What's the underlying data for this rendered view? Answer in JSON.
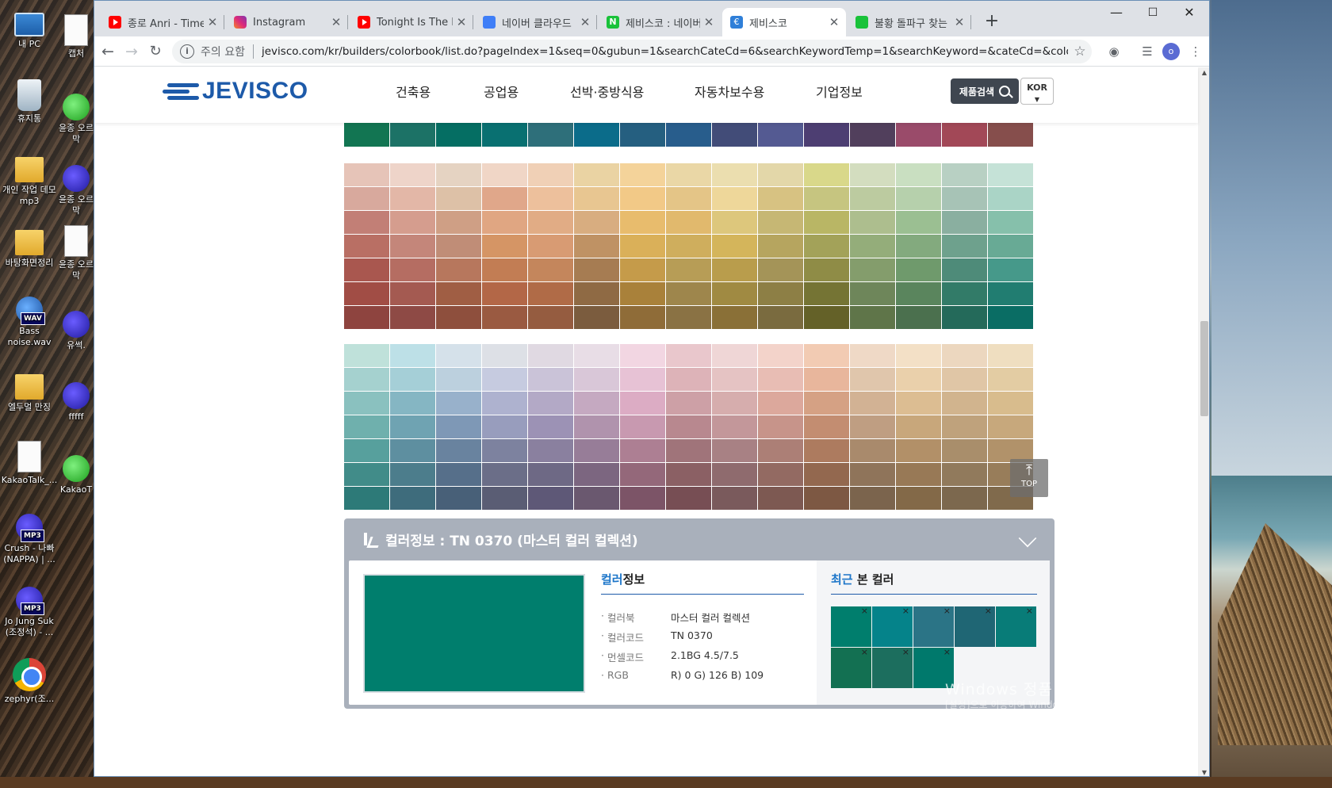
{
  "desktop": {
    "icons": [
      {
        "label": "내 PC",
        "kind": "pc",
        "badge": ""
      },
      {
        "label": "캡처",
        "kind": "doc",
        "badge": ""
      },
      {
        "label": "휴지통",
        "kind": "bin",
        "badge": ""
      },
      {
        "label": "윤종 오르막",
        "kind": "kakao",
        "badge": ""
      },
      {
        "label": "개인 작업 데모 mp3",
        "kind": "folder",
        "badge": ""
      },
      {
        "label": "윤종 오르막",
        "kind": "mp3",
        "badge": ""
      },
      {
        "label": "바탕화면정리",
        "kind": "folder",
        "badge": ""
      },
      {
        "label": "윤종 오르막",
        "kind": "doc",
        "badge": ""
      },
      {
        "label": "Bass noise.wav",
        "kind": "wav",
        "badge": "WAV"
      },
      {
        "label": "유썩.",
        "kind": "mp3",
        "badge": ""
      },
      {
        "label": "엘두멀 만징",
        "kind": "folder",
        "badge": ""
      },
      {
        "label": "fffff",
        "kind": "mp3",
        "badge": ""
      },
      {
        "label": "KakaoTalk_...",
        "kind": "doc",
        "badge": ""
      },
      {
        "label": "KakaoT",
        "kind": "kakao",
        "badge": ""
      },
      {
        "label": "Crush - 나빠 (NAPPA) | ...",
        "kind": "mp3",
        "badge": "MP3"
      },
      {
        "label": "Jo Jung Suk (조정석) - ...",
        "kind": "mp3",
        "badge": "MP3"
      },
      {
        "label": "zephyr(조...",
        "kind": "chrome",
        "badge": ""
      }
    ],
    "watermark_title": "Windows 정품 인증",
    "watermark_sub": "[설정]으로 이동하여 Windows를 정품 인증합니다."
  },
  "browser": {
    "tabs": [
      {
        "title": "종로 Anri - Timely",
        "favicon": "yt"
      },
      {
        "title": "Instagram",
        "favicon": "ig"
      },
      {
        "title": "Tonight Is The Nig",
        "favicon": "yt"
      },
      {
        "title": "네이버 클라우드",
        "favicon": "nc"
      },
      {
        "title": "제비스코 : 네이버",
        "favicon": "nv"
      },
      {
        "title": "제비스코",
        "favicon": "jv"
      },
      {
        "title": "불황 돌파구 찾는",
        "favicon": "gr"
      }
    ],
    "new_tab": "+",
    "window_controls": {
      "minimize": "—",
      "maximize": "☐",
      "close": "✕"
    },
    "security_text": "주의 요함",
    "url": "jevisco.com/kr/builders/colorbook/list.do?pageIndex=1&seq=0&gubun=1&searchCateCd=6&searchKeywordTemp=1&searchKeyword=&cateCd=&colorch...",
    "profile_initial": "o"
  },
  "site": {
    "logo": "JEVISCO",
    "nav": [
      "건축용",
      "공업용",
      "선박·중방식용",
      "자동차보수용",
      "기업정보"
    ],
    "search_button": "제품검색",
    "lang_button": "KOR",
    "top_button": "TOP",
    "palette_top_row": [
      "#127552",
      "#1c7266",
      "#056e63",
      "#097071",
      "#2e6f7a",
      "#0b6c8a",
      "#255f80",
      "#285d8c",
      "#424c78",
      "#545a92",
      "#4d3e72",
      "#513f5c",
      "#9a4b6a",
      "#a24857",
      "#864e4c"
    ],
    "palette_warm": [
      [
        "#e6c4b8",
        "#eed4c9",
        "#e5d3c2",
        "#f0d6c6",
        "#f0d0b6",
        "#ead3a3",
        "#f4d39a",
        "#ead7a6",
        "#ebdeaf",
        "#e3d7a9",
        "#d9d88a",
        "#d3ddbf",
        "#c9dfc1",
        "#b8d0c3",
        "#c5e2d7"
      ],
      [
        "#d8a99d",
        "#e3b7a7",
        "#ddc1a7",
        "#e0a78a",
        "#edc09c",
        "#e8c691",
        "#f2c987",
        "#e4c587",
        "#eed79a",
        "#d7c282",
        "#c6c580",
        "#bccba0",
        "#b6d0ac",
        "#a7c3b6",
        "#aad4c6"
      ],
      [
        "#c27f76",
        "#d59d8e",
        "#cf9f85",
        "#e0a682",
        "#e1ac85",
        "#d8ad80",
        "#e8bc6d",
        "#e1b96d",
        "#ddc77c",
        "#c6b774",
        "#b9b665",
        "#adbe8e",
        "#9bbf92",
        "#8aafa0",
        "#86c0ab"
      ],
      [
        "#b96f64",
        "#c4867a",
        "#c08d77",
        "#d59565",
        "#d89b73",
        "#bf9264",
        "#dab059",
        "#cfae5d",
        "#d4b55b",
        "#b6a55f",
        "#a3a259",
        "#94ad7a",
        "#83aa7e",
        "#6ea18d",
        "#68aa95"
      ],
      [
        "#a9574f",
        "#b56d62",
        "#b7775d",
        "#c27d54",
        "#c4865c",
        "#a67c52",
        "#c59b4a",
        "#b79d56",
        "#b99d4c",
        "#a49458",
        "#8f8c46",
        "#849d6c",
        "#6f9a6c",
        "#4e8b79",
        "#46998a"
      ],
      [
        "#a14d45",
        "#a45a51",
        "#a05e44",
        "#b36747",
        "#b06b47",
        "#8f6a44",
        "#a9813a",
        "#9e864c",
        "#a08a42",
        "#8d7f45",
        "#757434",
        "#6e865a",
        "#5a855d",
        "#327b68",
        "#217d71"
      ],
      [
        "#8e443f",
        "#8e4a45",
        "#8e4f3d",
        "#9a5a41",
        "#955c40",
        "#7b5c3e",
        "#8f6c38",
        "#8a7244",
        "#8a7037",
        "#7a6b3f",
        "#646128",
        "#5f7549",
        "#4b704e",
        "#246a5a",
        "#0a6d64"
      ]
    ],
    "palette_cool": [
      [
        "#bfe1da",
        "#bde0e7",
        "#d5e1ea",
        "#dde0e6",
        "#e0d9e2",
        "#e8dde6",
        "#f2d6e2",
        "#e9c7cc",
        "#efd6d6",
        "#f3d3ca",
        "#f2cbb3",
        "#efd9c6",
        "#f3e0c6",
        "#ecd7bf",
        "#efdec0"
      ],
      [
        "#a5d1cf",
        "#a5cfd7",
        "#bcd0de",
        "#c6cbe0",
        "#cac3d8",
        "#d9c7d8",
        "#e7c2d5",
        "#ddb3b8",
        "#e5c3c3",
        "#e8bdb4",
        "#e8b69c",
        "#e0c6ac",
        "#ead0ab",
        "#e0c6a6",
        "#e3cca3"
      ],
      [
        "#8ac1bf",
        "#85b6c3",
        "#98b1cb",
        "#aeb2cf",
        "#b3a9c6",
        "#c5a9c1",
        "#dcacc4",
        "#cda0a6",
        "#d6adad",
        "#dca89c",
        "#d5a184",
        "#d2b294",
        "#dcbd92",
        "#d1b48e",
        "#d8bc8d"
      ],
      [
        "#6fb0ad",
        "#6fa3b2",
        "#7e98b6",
        "#989dbd",
        "#9c92b5",
        "#b093ad",
        "#c899b0",
        "#b8888f",
        "#c3979a",
        "#c7948a",
        "#c38d71",
        "#bf9e82",
        "#c8a77b",
        "#bfa27c",
        "#c7a87c"
      ],
      [
        "#57a09d",
        "#5e8fa0",
        "#69839f",
        "#7d829f",
        "#8a809f",
        "#977d98",
        "#ad7f93",
        "#a0747a",
        "#a88184",
        "#ac7f76",
        "#ad7b5f",
        "#a98a6c",
        "#b29068",
        "#a98e6b",
        "#b1926a"
      ],
      [
        "#418c89",
        "#4c7d8c",
        "#566f8a",
        "#6b6e88",
        "#6e6985",
        "#7c6680",
        "#94687a",
        "#8b6064",
        "#8f6b6e",
        "#936a62",
        "#93684f",
        "#8f745a",
        "#987956",
        "#917a5c",
        "#987d5a"
      ],
      [
        "#2d7a78",
        "#3e6c7c",
        "#486078",
        "#5a5d74",
        "#5e5877",
        "#6a586f",
        "#7c5467",
        "#774e54",
        "#7a5a5c",
        "#7d5952",
        "#7d5843",
        "#7b644d",
        "#836948",
        "#7c684e",
        "#806a4c"
      ]
    ],
    "info": {
      "header": "컬러정보 : TN 0370 (마스터 컬러 컬렉션)",
      "color_hex": "#007e6d",
      "section_title_hl": "컬러",
      "section_title_rest": "정보",
      "recent_title_hl": "최근",
      "recent_title_rest": " 본 컬러",
      "rows": [
        {
          "key": "컬러북",
          "value": "마스터 컬러 컬렉션"
        },
        {
          "key": "컬러코드",
          "value": "TN 0370"
        },
        {
          "key": "먼셀코드",
          "value": "2.1BG 4.5/7.5"
        },
        {
          "key": "RGB",
          "value": "R) 0 G) 126 B) 109"
        }
      ],
      "recent_colors": [
        "#007e6d",
        "#05838a",
        "#2b7486",
        "#1f6674",
        "#087c78",
        "#137052",
        "#1c6e5e",
        "#00796c"
      ],
      "remove_glyph": "×"
    }
  }
}
